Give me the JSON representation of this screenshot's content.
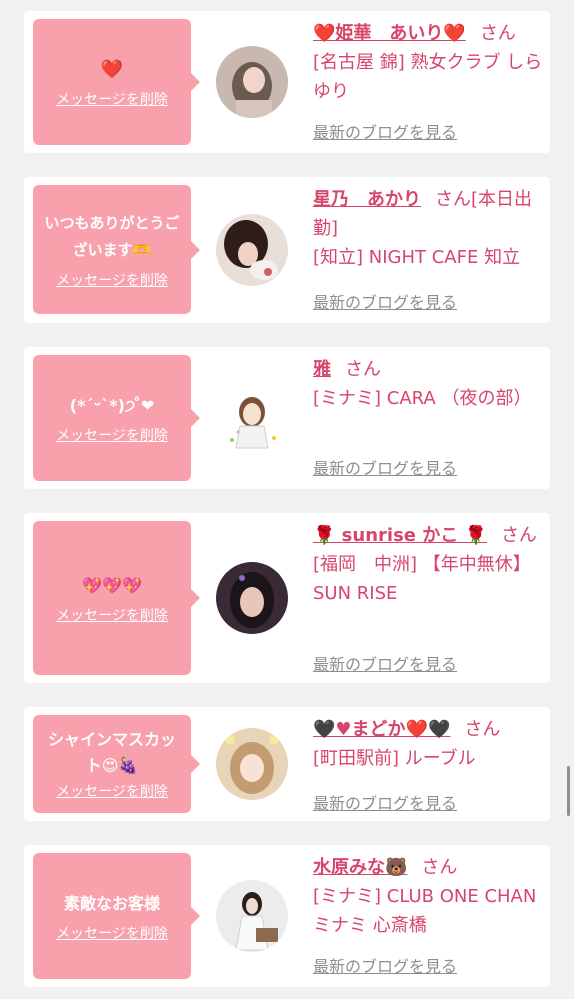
{
  "messages": [
    {
      "message": "❤️",
      "delete_label": "メッセージを削除",
      "name": "❤️姫華　あいり❤️",
      "honorific": "さん",
      "shop": "[名古屋 錦] 熟女クラブ しらゆり",
      "blog_link": "最新のブログを見る"
    },
    {
      "message": "いつもありがとうございます🫶",
      "delete_label": "メッセージを削除",
      "name": "星乃　あかり",
      "honorific": "さん[本日出勤]",
      "shop": "[知立] NIGHT CAFE 知立",
      "blog_link": "最新のブログを見る"
    },
    {
      "message": "(*ˊᵕˋ*)੭ ̊❤",
      "delete_label": "メッセージを削除",
      "name": "雅",
      "honorific": "さん",
      "shop": "[ミナミ] CARA （夜の部）",
      "blog_link": "最新のブログを見る"
    },
    {
      "message": "💖💖💖",
      "delete_label": "メッセージを削除",
      "name": "🌹 sunrise かこ 🌹",
      "honorific": "さん",
      "shop": "[福岡　中洲] 【年中無休】SUN RISE",
      "blog_link": "最新のブログを見る"
    },
    {
      "message": "シャインマスカット😍🍇",
      "delete_label": "メッセージを削除",
      "name": "🖤♥まどか❤️🖤",
      "honorific": "さん",
      "shop": "[町田駅前] ルーブル",
      "blog_link": "最新のブログを見る"
    },
    {
      "message": "素敵なお客様",
      "delete_label": "メッセージを削除",
      "name": "水原みな🐻",
      "honorific": "さん",
      "shop": "[ミナミ] CLUB ONE CHAN ミナミ 心斎橋",
      "blog_link": "最新のブログを見る"
    }
  ],
  "colors": {
    "accent": "#d7466a",
    "bubble": "#f8a1ad",
    "link_gray": "#8e8e8e",
    "background": "#f1f1f1"
  }
}
